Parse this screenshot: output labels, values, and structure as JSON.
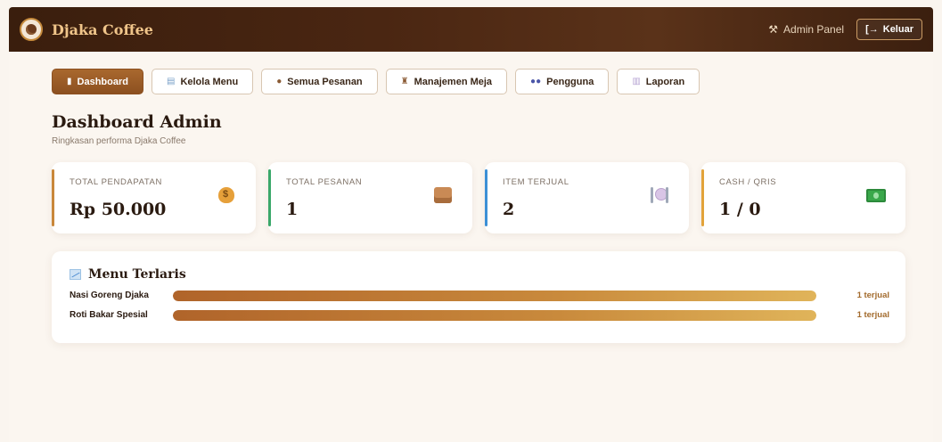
{
  "header": {
    "brand": "Djaka Coffee",
    "admin_panel": "Admin Panel",
    "logout": "Keluar"
  },
  "tabs": [
    {
      "label": "Dashboard",
      "icon": "bar-chart-icon",
      "active": true
    },
    {
      "label": "Kelola Menu",
      "icon": "menu-list-icon",
      "active": false
    },
    {
      "label": "Semua Pesanan",
      "icon": "coffee-bean-icon",
      "active": false
    },
    {
      "label": "Manajemen Meja",
      "icon": "chair-icon",
      "active": false
    },
    {
      "label": "Pengguna",
      "icon": "users-icon",
      "active": false
    },
    {
      "label": "Laporan",
      "icon": "report-icon",
      "active": false
    }
  ],
  "page": {
    "title": "Dashboard Admin",
    "subtitle": "Ringkasan performa Djaka Coffee"
  },
  "stats": [
    {
      "label": "TOTAL PENDAPATAN",
      "value": "Rp 50.000",
      "accent": "#c9873a",
      "icon": "money-bag-icon"
    },
    {
      "label": "TOTAL PESANAN",
      "value": "1",
      "accent": "#3aa86a",
      "icon": "package-icon"
    },
    {
      "label": "ITEM TERJUAL",
      "value": "2",
      "accent": "#3b8fd6",
      "icon": "plate-cutlery-icon"
    },
    {
      "label": "CASH / QRIS",
      "value": "1 / 0",
      "accent": "#e2a33a",
      "icon": "cash-icon"
    }
  ],
  "best_sellers": {
    "title": "Menu Terlaris",
    "items": [
      {
        "name": "Nasi Goreng Djaka",
        "count": "1 terjual",
        "fraction": 1.0
      },
      {
        "name": "Roti Bakar Spesial",
        "count": "1 terjual",
        "fraction": 1.0
      }
    ]
  },
  "colors": {
    "header_bg": "#4a2612",
    "brand_text": "#f0c58a",
    "active_tab": "#9a5c26",
    "page_bg": "#faf5ef"
  }
}
